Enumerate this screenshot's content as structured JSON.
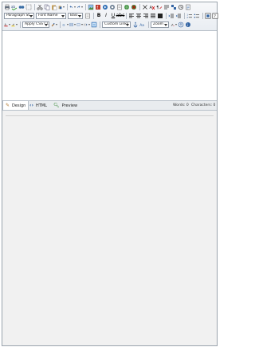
{
  "toolbar": {
    "paragraph_style": "Paragraph St...",
    "font_name": "Font Name",
    "font_size": "Basi...",
    "apply_css_class": "Apply CSS Cl...",
    "custom_links": "Custom Links",
    "zoom": "Zoom"
  },
  "tabs": {
    "design": "Design",
    "html": "HTML",
    "preview": "Preview"
  },
  "status": {
    "words": "Words: 0",
    "characters": "Characters: 0"
  },
  "icons": [
    "print-icon",
    "spellcheck-icon",
    "find-icon",
    "select-all-icon",
    "cut-icon",
    "copy-icon",
    "paste-icon",
    "paste-from-word-icon",
    "undo-icon",
    "redo-icon",
    "image-manager-icon",
    "flash-manager-icon",
    "media-manager-icon",
    "document-manager-icon",
    "template-manager-icon",
    "hyperlink-icon",
    "remove-link-icon",
    "strip-format-icon",
    "insert-table-icon",
    "bold-icon",
    "italic-icon",
    "underline-icon",
    "strikethrough-icon",
    "align-left-icon",
    "align-center-icon",
    "align-right-icon",
    "justify-icon",
    "indent-icon",
    "outdent-icon",
    "numbered-list-icon",
    "bullet-list-icon",
    "fullscreen-icon",
    "help-icon"
  ],
  "colors": {
    "toolbar_bg": "#eceff3",
    "border": "#9aa3ad",
    "lower_bg": "#f1f1f1",
    "icon_blue": "#2e4d7b"
  }
}
